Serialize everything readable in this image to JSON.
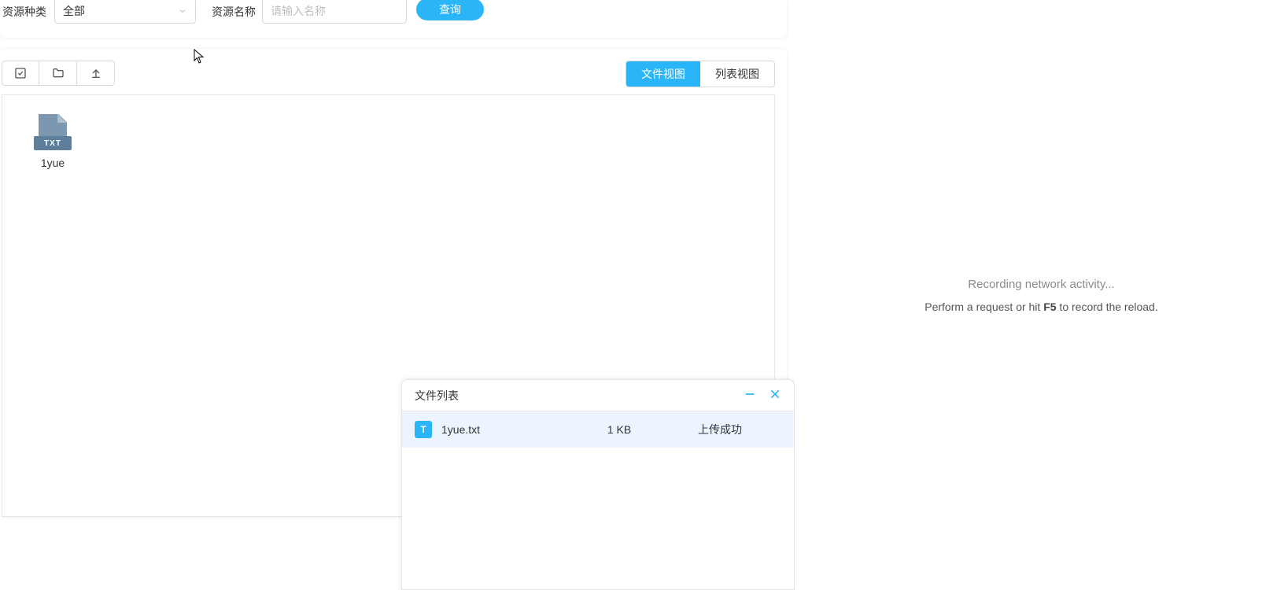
{
  "filter": {
    "category_label": "资源种类",
    "category_selected": "全部",
    "name_label": "资源名称",
    "name_placeholder": "请输入名称",
    "query_button": "查询"
  },
  "view_switch": {
    "file_view": "文件视图",
    "list_view": "列表视图"
  },
  "files": [
    {
      "name": "1yue",
      "ext_label": "TXT"
    }
  ],
  "upload_popup": {
    "title": "文件列表",
    "rows": [
      {
        "icon_letter": "T",
        "name": "1yue.txt",
        "size": "1 KB",
        "status": "上传成功"
      }
    ]
  },
  "devtools": {
    "recording": "Recording network activity...",
    "hint_prefix": "Perform a request or hit ",
    "hint_key": "F5",
    "hint_suffix": " to record the reload."
  }
}
